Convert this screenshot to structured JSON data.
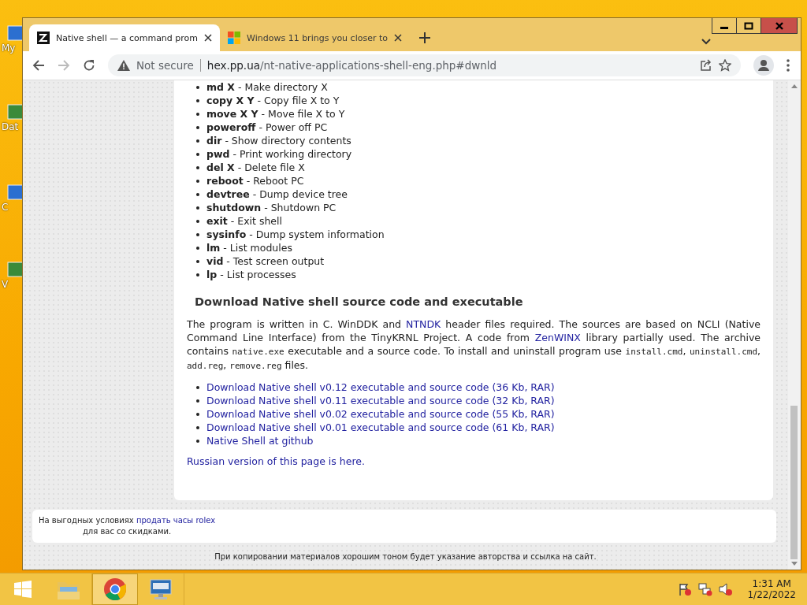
{
  "desktop": {
    "icons": [
      {
        "label": "My"
      },
      {
        "label": "Dat"
      },
      {
        "label": "C"
      },
      {
        "label": "V"
      }
    ]
  },
  "browser": {
    "tabs": [
      {
        "title": "Native shell — a command prom",
        "selected": true,
        "kind": "zn"
      },
      {
        "title": "Windows 11 brings you closer to",
        "selected": false,
        "kind": "windows"
      }
    ],
    "address_bar": {
      "security": "Not secure",
      "domain": "hex.pp.ua",
      "path": "/nt-native-applications-shell-eng.php#dwnld"
    }
  },
  "page": {
    "commands": [
      "**md X** - Make directory X",
      "**copy X Y** - Copy file X to Y",
      "**move X Y** - Move file X to Y",
      "**poweroff** - Power off PC",
      "**dir** - Show directory contents",
      "**pwd** - Print working directory",
      "**del X** - Delete file X",
      "**reboot** - Reboot PC",
      "**devtree** - Dump device tree",
      "**shutdown** - Shutdown PC",
      "**exit** - Exit shell",
      "**sysinfo** - Dump system information",
      "**lm** - List modules",
      "**vid** - Test screen output",
      "**lp** - List processes"
    ],
    "heading": "Download Native shell source code and executable",
    "paragraph": [
      {
        "kind": "text",
        "text": "The program is written in C. WinDDK and "
      },
      {
        "kind": "link",
        "text": "NTNDK"
      },
      {
        "kind": "text",
        "text": " header files required. The sources are based on NCLI (Native Command Line Interface) from the TinyKRNL Project. A code from "
      },
      {
        "kind": "link",
        "text": "ZenWINX"
      },
      {
        "kind": "text",
        "text": " library partially used. The archive contains "
      },
      {
        "kind": "code",
        "text": "native.exe"
      },
      {
        "kind": "text",
        "text": " executable and a source code. To install and uninstall program use "
      },
      {
        "kind": "code",
        "text": "install.cmd"
      },
      {
        "kind": "text",
        "text": ", "
      },
      {
        "kind": "code",
        "text": "uninstall.cmd"
      },
      {
        "kind": "text",
        "text": ", "
      },
      {
        "kind": "code",
        "text": "add.reg"
      },
      {
        "kind": "text",
        "text": ", "
      },
      {
        "kind": "code",
        "text": "remove.reg"
      },
      {
        "kind": "text",
        "text": " files."
      }
    ],
    "downloads": [
      "Download Native shell v0.12 executable and source code (36 Kb, RAR)",
      "Download Native shell v0.11 executable and source code (32 Kb, RAR)",
      "Download Native shell v0.02 executable and source code (55 Kb, RAR)",
      "Download Native shell v0.01 executable and source code (61 Kb, RAR)",
      "Native Shell at github"
    ],
    "russian_link": "Russian version of this page is here.",
    "ad": {
      "line1": [
        {
          "kind": "text",
          "text": "На выгодных условиях "
        },
        {
          "kind": "link",
          "text": "продать часы rolex"
        }
      ],
      "line2": "для вас со скидками."
    },
    "footer": "При копировании материалов хорошим тоном будет указание авторства и ссылка на сайт."
  },
  "taskbar": {
    "apps": [
      {
        "kind": "explorer",
        "selected": false
      },
      {
        "kind": "chrome",
        "selected": true
      },
      {
        "kind": "remote",
        "selected": false
      }
    ],
    "time": "1:31 AM",
    "date": "1/22/2022"
  }
}
